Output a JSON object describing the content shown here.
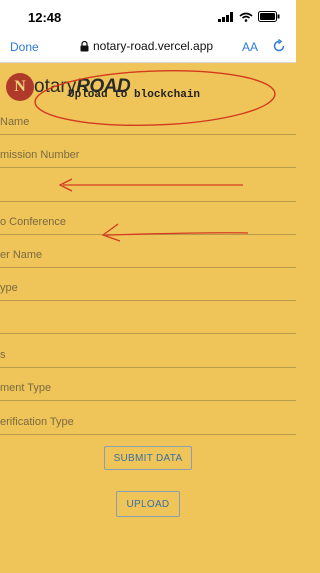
{
  "status_bar": {
    "time": "12:48"
  },
  "browser": {
    "done_label": "Done",
    "url": "notary-road.vercel.app",
    "aa_label": "AA"
  },
  "brand": {
    "prefix": "otary",
    "suffix": "ROAD",
    "seal_letter": "N"
  },
  "handwritten_note": "Upload to blockchain",
  "fields": [
    {
      "label": "Name"
    },
    {
      "label": "mission Number"
    },
    {
      "label": ""
    },
    {
      "label": "o Conference"
    },
    {
      "label": "er Name"
    },
    {
      "label": "ype"
    },
    {
      "label": ""
    },
    {
      "label": "s"
    },
    {
      "label": "ment Type"
    },
    {
      "label": "erification Type"
    }
  ],
  "buttons": {
    "submit_label": "SUBMIT DATA",
    "upload_label": "UPLOAD"
  },
  "colors": {
    "background": "#efc55a",
    "annotation": "#d23a1f",
    "button_text": "#3b6fa1"
  }
}
